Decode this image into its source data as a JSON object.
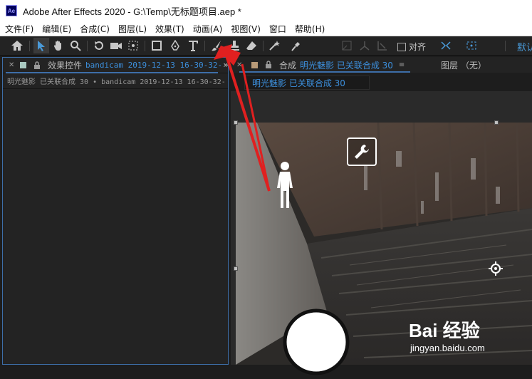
{
  "window": {
    "app_logo": "Ae",
    "title": "Adobe After Effects 2020 - G:\\Temp\\无标题项目.aep *"
  },
  "menu": [
    "文件(F)",
    "编辑(E)",
    "合成(C)",
    "图层(L)",
    "效果(T)",
    "动画(A)",
    "视图(V)",
    "窗口",
    "帮助(H)"
  ],
  "toolbar": {
    "snap_label": "对齐",
    "right_text": "默认"
  },
  "effects_panel": {
    "tab_label": "效果控件",
    "tab_link": "bandicam 2019-12-13 16-30-32-",
    "subheader": "明光魅影 已关联合成 30 • bandicam 2019-12-13 16-30-32-"
  },
  "comp_panel": {
    "tab_label": "合成",
    "comp_name": "明光魅影 已关联合成 30",
    "layer_label": "图层 （无）",
    "breadcrumb": "明光魅影 已关联合成 30"
  },
  "watermark": {
    "logo": "Bai 经验",
    "url": "jingyan.baidu.com"
  },
  "colors": {
    "accent_blue": "#3c8fdc",
    "annotation_red": "#e02020",
    "swatch_panel": "#a8c8c0",
    "swatch_comp": "#b89a78"
  }
}
